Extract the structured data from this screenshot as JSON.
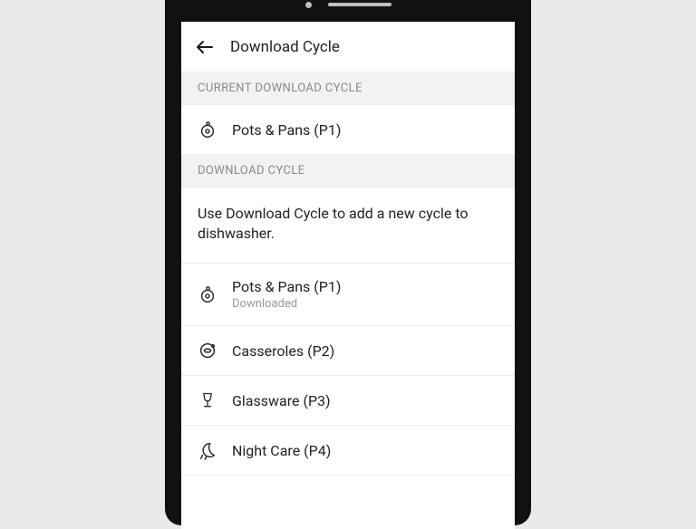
{
  "header": {
    "title": "Download Cycle"
  },
  "sections": {
    "current_header": "CURRENT DOWNLOAD CYCLE",
    "cycles_header": "DOWNLOAD CYCLE",
    "description": "Use Download Cycle to add a new cycle to dishwasher."
  },
  "current": {
    "label": "Pots & Pans (P1)"
  },
  "cycles": [
    {
      "label": "Pots & Pans (P1)",
      "sub": "Downloaded"
    },
    {
      "label": "Casseroles (P2)"
    },
    {
      "label": "Glassware (P3)"
    },
    {
      "label": "Night Care (P4)"
    }
  ]
}
